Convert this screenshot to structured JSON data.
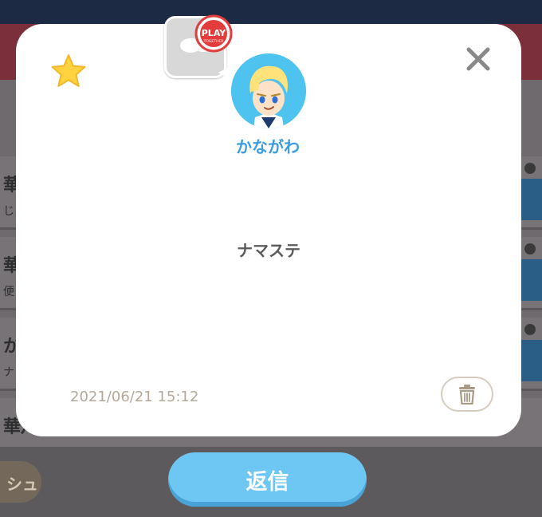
{
  "sender": {
    "name": "かながわ"
  },
  "message": {
    "text": "ナマステ",
    "timestamp": "2021/06/21 15:12"
  },
  "actions": {
    "reply_label": "返信"
  },
  "badge": {
    "text": "PLAY TOGETHER"
  },
  "background": {
    "rows": [
      {
        "name": "華",
        "sub": "じ"
      },
      {
        "name": "華",
        "sub": "便"
      },
      {
        "name": "か",
        "sub": "ナ"
      },
      {
        "name": "華乃",
        "sub": ""
      }
    ],
    "left_pill": "シュ"
  },
  "icons": {
    "favorite": "star-icon",
    "close": "close-icon",
    "delete": "trash-icon"
  },
  "colors": {
    "accent": "#6ec6f2",
    "username": "#3a9de0",
    "star": "#ffd23f",
    "close": "#888888"
  }
}
